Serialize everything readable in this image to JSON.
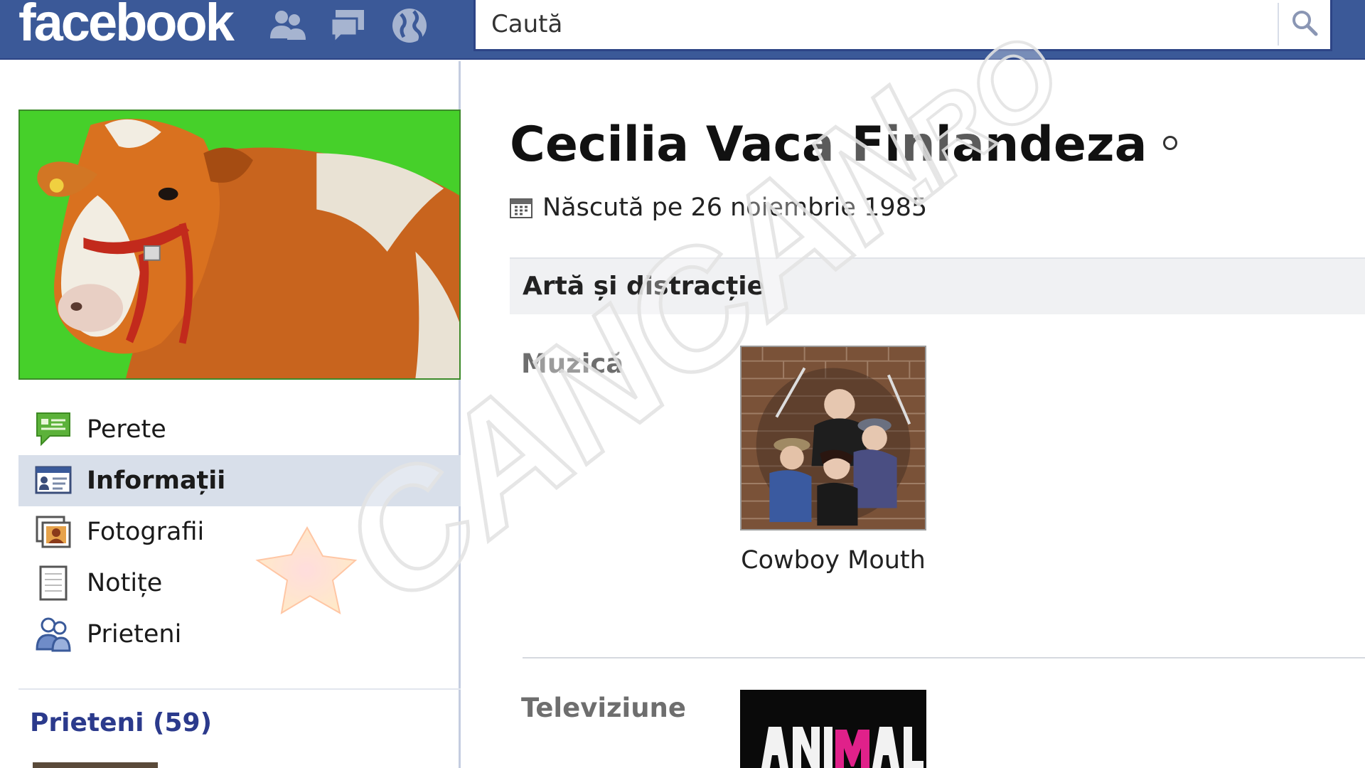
{
  "topbar": {
    "logo_text": "facebook",
    "jewels": [
      {
        "icon": "friend-requests-icon"
      },
      {
        "icon": "messages-icon"
      },
      {
        "icon": "notifications-globe-icon"
      }
    ],
    "search": {
      "placeholder": "Caută",
      "button_icon": "search-icon"
    }
  },
  "sidebar": {
    "profile_picture": "cow-photo",
    "items": [
      {
        "label": "Perete",
        "icon": "wall-speech-bubble-icon",
        "selected": false
      },
      {
        "label": "Informații",
        "icon": "info-card-icon",
        "selected": true
      },
      {
        "label": "Fotografii",
        "icon": "photos-icon",
        "selected": false
      },
      {
        "label": "Notițe",
        "icon": "notes-icon",
        "selected": false
      },
      {
        "label": "Prieteni",
        "icon": "friends-icon",
        "selected": false
      }
    ],
    "friends_heading": "Prieteni (59)"
  },
  "profile": {
    "name": "Cecilia Vaca Finlandeza",
    "birthday": "Născută pe 26 noiembrie 1985",
    "birthday_icon": "calendar-icon"
  },
  "info": {
    "section_title": "Artă și distracție",
    "categories": [
      {
        "label": "Muzică",
        "items": [
          {
            "caption": "Cowboy Mouth",
            "image": "band-photo"
          }
        ]
      },
      {
        "label": "Televiziune",
        "items": [
          {
            "caption": "",
            "image": "animal-planet-logo"
          }
        ]
      }
    ]
  },
  "watermark": {
    "text": "CANCAN.RO",
    "logo_text": "CANCAN",
    "logo_suffix": ".RO"
  },
  "colors": {
    "topbar": "#3b5998",
    "selected_nav": "#d8dfea",
    "friends_heading": "#2b3a8c",
    "profile_pic_bg": "#47d42a"
  }
}
